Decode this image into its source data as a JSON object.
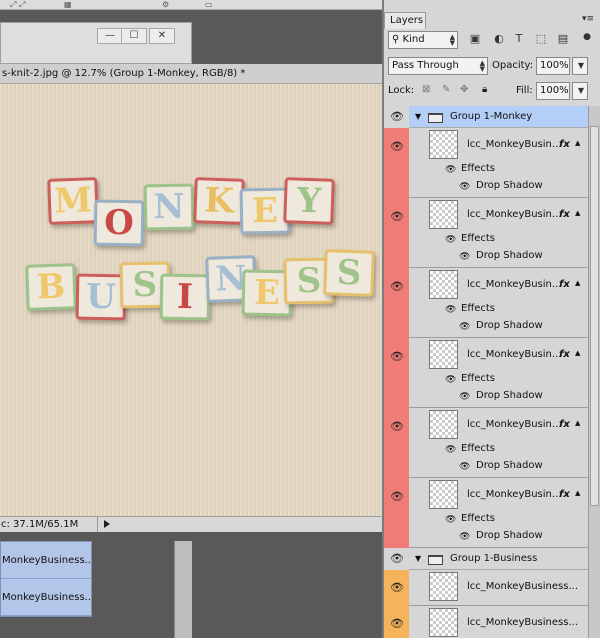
{
  "document": {
    "title": "s-knit-2.jpg @ 12.7% (Group 1-Monkey, RGB/8) *",
    "window_buttons": [
      "—",
      "☐",
      "✕"
    ],
    "status": "c: 37.1M/65.1M"
  },
  "artwork": {
    "row1": [
      "M",
      "O",
      "N",
      "K",
      "E",
      "Y"
    ],
    "row2": [
      "B",
      "U",
      "S",
      "I",
      "N",
      "E",
      "S",
      "S"
    ]
  },
  "mini_layers": [
    "MonkeyBusiness...",
    "MonkeyBusiness..."
  ],
  "panel": {
    "tab_label": "Layers",
    "menu_icon": "panel-menu-icon",
    "filter_kind": "Kind",
    "blend_mode": "Pass Through",
    "opacity_label": "Opacity:",
    "opacity_value": "100%",
    "lock_label": "Lock:",
    "fill_label": "Fill:",
    "fill_value": "100%"
  },
  "colors": {
    "selection": "#b3cef7",
    "vis_red": "#f07c77",
    "vis_orange": "#f5b45c"
  },
  "groups": [
    {
      "name": "Group 1-Monkey",
      "selected": true,
      "color": "red",
      "layers": [
        {
          "name": "lcc_MonkeyBusin...",
          "fx": "fx",
          "effects": "Effects",
          "effect": "Drop Shadow"
        },
        {
          "name": "lcc_MonkeyBusin...",
          "fx": "fx",
          "effects": "Effects",
          "effect": "Drop Shadow"
        },
        {
          "name": "lcc_MonkeyBusin...",
          "fx": "fx",
          "effects": "Effects",
          "effect": "Drop Shadow"
        },
        {
          "name": "lcc_MonkeyBusin...",
          "fx": "fx",
          "effects": "Effects",
          "effect": "Drop Shadow"
        },
        {
          "name": "lcc_MonkeyBusin...",
          "fx": "fx",
          "effects": "Effects",
          "effect": "Drop Shadow"
        },
        {
          "name": "lcc_MonkeyBusin...",
          "fx": "fx",
          "effects": "Effects",
          "effect": "Drop Shadow"
        }
      ]
    },
    {
      "name": "Group 1-Business",
      "selected": false,
      "color": "orange",
      "layers": [
        {
          "name": "lcc_MonkeyBusiness..."
        },
        {
          "name": "lcc_MonkeyBusiness..."
        }
      ]
    }
  ]
}
